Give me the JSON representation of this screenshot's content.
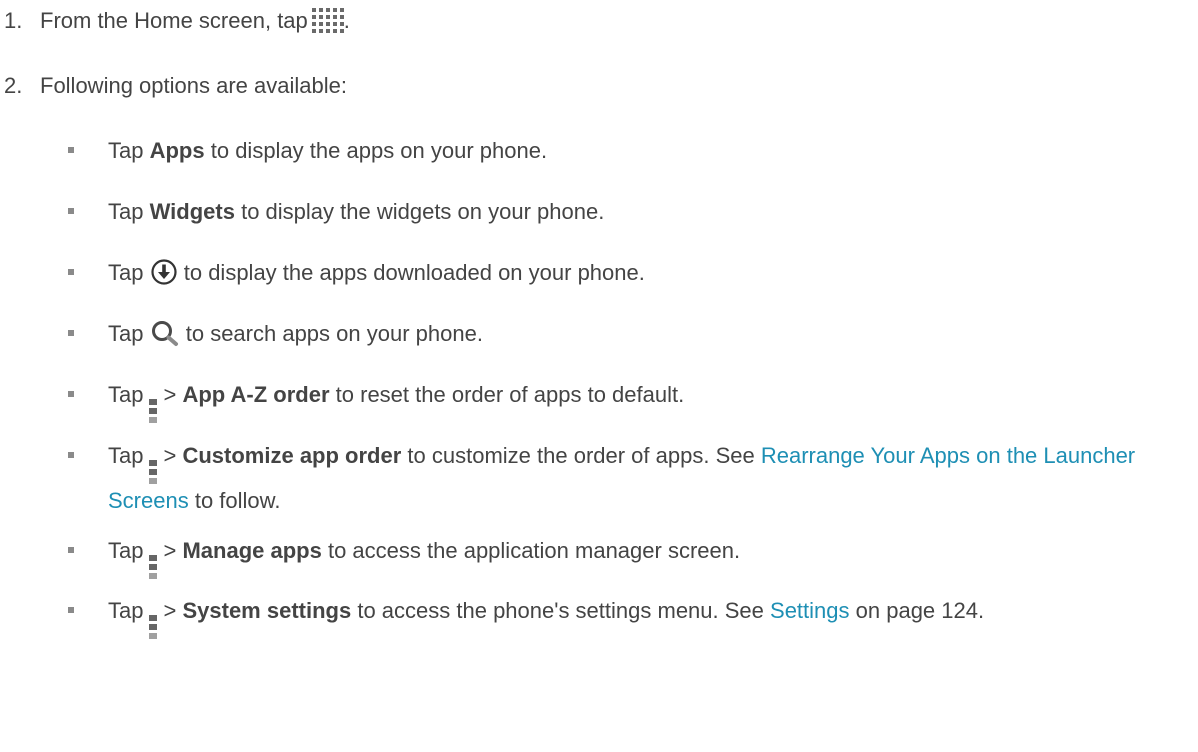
{
  "steps": [
    {
      "num": "1.",
      "before": "From the Home screen, tap",
      "after": "."
    },
    {
      "num": "2.",
      "text": "Following options are available:"
    }
  ],
  "icons": {
    "apps_grid": "apps-grid-icon",
    "download": "download-icon",
    "search": "search-icon",
    "menu": "overflow-menu-icon"
  },
  "bullets": {
    "apps": {
      "tap": "Tap",
      "bold": "Apps",
      "rest": "to display the apps on your phone."
    },
    "widgets": {
      "tap": "Tap",
      "bold": "Widgets",
      "rest": "to display the widgets on your phone."
    },
    "downloaded": {
      "tap": "Tap",
      "rest": "to display the apps downloaded on your phone."
    },
    "search": {
      "tap": "Tap",
      "rest": "to search apps on your phone."
    },
    "az_order": {
      "tap": "Tap",
      "sep": ">",
      "bold": "App A-Z order",
      "rest": "to reset the order of apps to default."
    },
    "customize": {
      "tap": "Tap",
      "sep": ">",
      "bold": "Customize app order",
      "rest": "to customize the order of apps. See",
      "link": "Rearrange Your Apps on the Launcher Screens",
      "after": "to follow."
    },
    "manage": {
      "tap": "Tap",
      "sep": ">",
      "bold": "Manage apps",
      "rest": "to access the application manager screen."
    },
    "system": {
      "tap": "Tap",
      "sep": ">",
      "bold": "System settings",
      "rest": "to access the phone's settings menu. See",
      "link": "Settings",
      "after": "on page 124."
    }
  },
  "colors": {
    "text": "#444444",
    "link": "#1e8fb4",
    "bullet": "#8a8a8a"
  }
}
